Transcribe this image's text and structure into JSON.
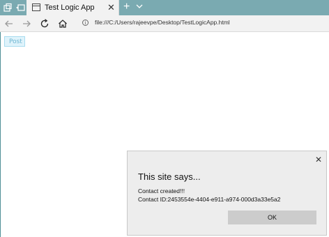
{
  "tab": {
    "title": "Test Logic App"
  },
  "address_bar": {
    "url": "file:///C:/Users/rajeevpe/Desktop/TestLogicApp.html"
  },
  "page": {
    "post_button_label": "Post"
  },
  "dialog": {
    "title": "This site says...",
    "message_line1": "Contact created!!!",
    "message_line2": "Contact ID:2453554e-4404-e911-a974-000d3a33e5a2",
    "ok_label": "OK"
  },
  "colors": {
    "titlebar": "#7aaab1",
    "tab_background": "#f2f2f2",
    "dialog_background": "#ededed",
    "ok_button": "#cccccc",
    "post_button_background": "#dff3fb",
    "post_button_text": "#6db5d1"
  },
  "icons": [
    "tab-actions-icon",
    "set-aside-tabs-icon",
    "page-icon",
    "close-icon",
    "new-tab-icon",
    "chevron-down-icon",
    "back-arrow-icon",
    "forward-arrow-icon",
    "refresh-icon",
    "home-icon",
    "info-icon"
  ]
}
